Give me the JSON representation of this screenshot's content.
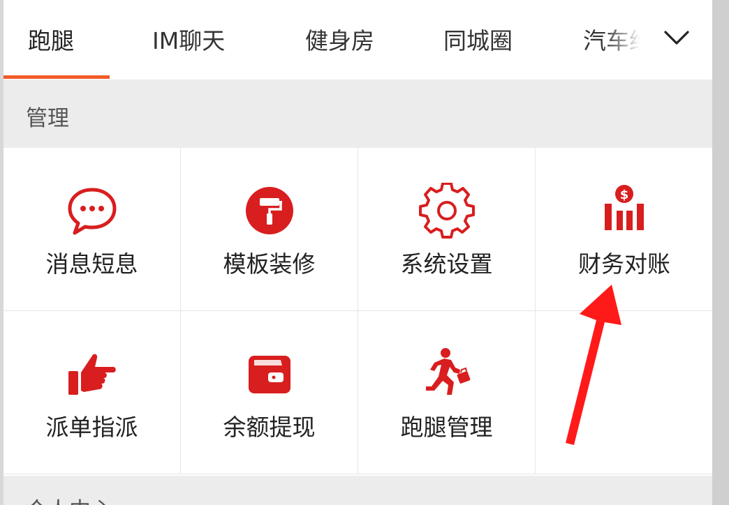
{
  "tabs": [
    {
      "label": "跑腿"
    },
    {
      "label": "IM聊天"
    },
    {
      "label": "健身房"
    },
    {
      "label": "同城圈"
    },
    {
      "label": "汽车给"
    }
  ],
  "accent_color": "#f05a28",
  "icon_color": "#d81e1e",
  "section": {
    "title": "管理"
  },
  "grid_items": [
    {
      "label": "消息短息",
      "icon": "chat-bubble-icon"
    },
    {
      "label": "模板装修",
      "icon": "paint-roller-icon"
    },
    {
      "label": "系统设置",
      "icon": "gear-icon"
    },
    {
      "label": "财务对账",
      "icon": "finance-chart-icon"
    },
    {
      "label": "派单指派",
      "icon": "pointing-hand-icon"
    },
    {
      "label": "余额提现",
      "icon": "wallet-icon"
    },
    {
      "label": "跑腿管理",
      "icon": "runner-icon"
    }
  ],
  "next_section": {
    "title": "个人中心"
  }
}
